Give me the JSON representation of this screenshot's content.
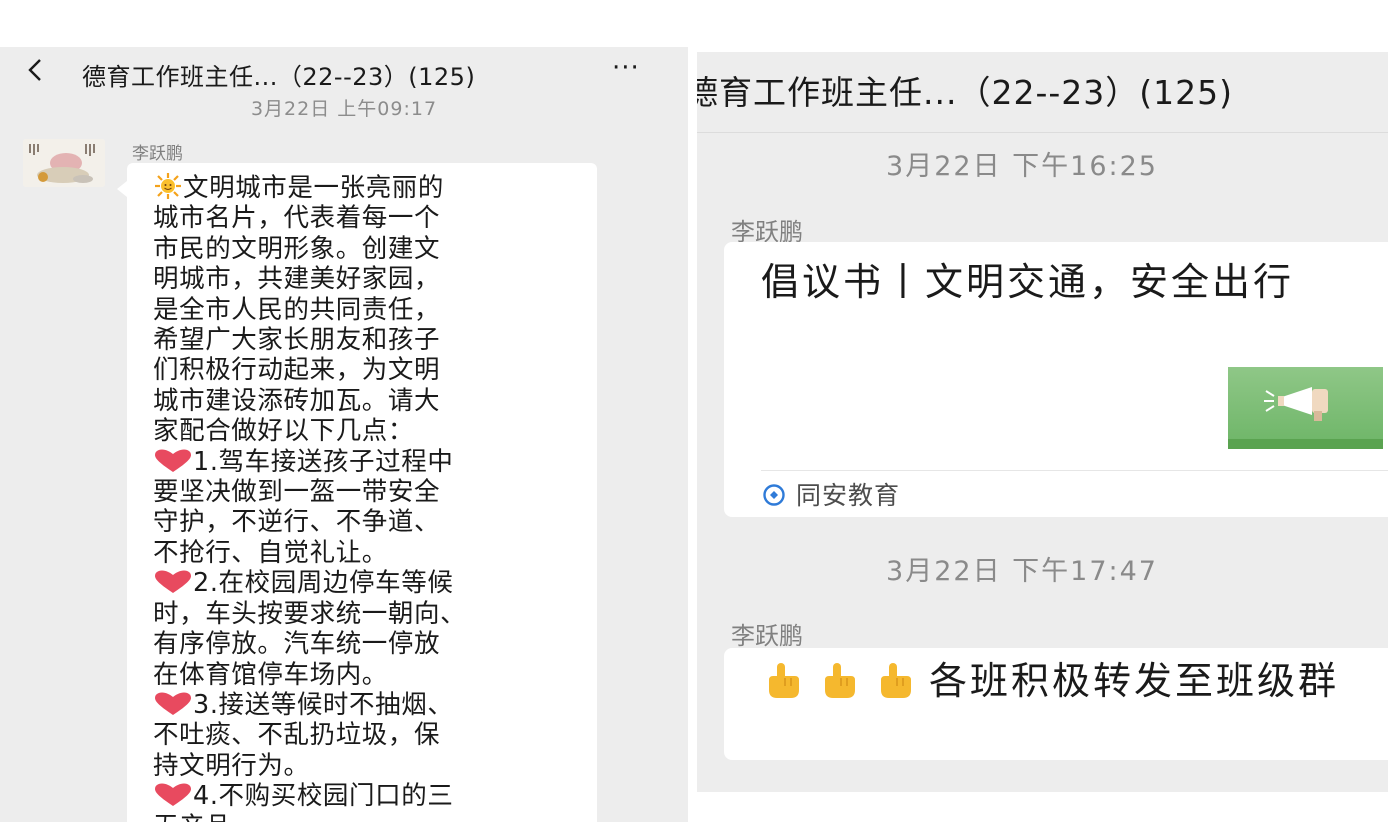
{
  "left": {
    "title": "德育工作班主任...（22--23）(125)",
    "more": "···",
    "timestamp": "3月22日 上午09:17",
    "sender": "李跃鹏",
    "message_lines": [
      "文明城市是一张亮丽的",
      "城市名片，代表着每一个",
      "市民的文明形象。创建文",
      "明城市，共建美好家园，",
      "是全市人民的共同责任，",
      "希望广大家长朋友和孩子",
      "们积极行动起来，为文明",
      "城市建设添砖加瓦。请大",
      "家配合做好以下几点：",
      "1.驾车接送孩子过程中",
      "要坚决做到一盔一带安全",
      "守护，不逆行、不争道、",
      "不抢行、自觉礼让。",
      "2.在校园周边停车等候",
      "时，车头按要求统一朝向、",
      "有序停放。汽车统一停放",
      "在体育馆停车场内。",
      "3.接送等候时不抽烟、",
      "不吐痰、不乱扔垃圾，保",
      "持文明行为。",
      "4.不购买校园门口的三",
      "无产品。"
    ]
  },
  "right": {
    "title": "德育工作班主任...（22--23）(125)",
    "timestamp1": "3月22日 下午16:25",
    "sender1": "李跃鹏",
    "card_title": "倡议书丨文明交通，安全出行",
    "card_source": "同安教育",
    "timestamp2": "3月22日 下午17:47",
    "sender2": "李跃鹏",
    "message2": "各班积极转发至班级群"
  },
  "icons": {
    "back": "chevron-left-icon",
    "sun": "sun-emoji-icon",
    "heart": "heart-emoji-icon",
    "pointing_hand": "pointing-hand-emoji-icon",
    "megaphone": "megaphone-thumbnail",
    "source": "official-account-icon"
  },
  "colors": {
    "chat_background": "#ededed",
    "bubble": "#ffffff",
    "heart": "#e84a5f",
    "thumbnail": "#7dbf74",
    "source_icon": "#2f7bd8"
  }
}
